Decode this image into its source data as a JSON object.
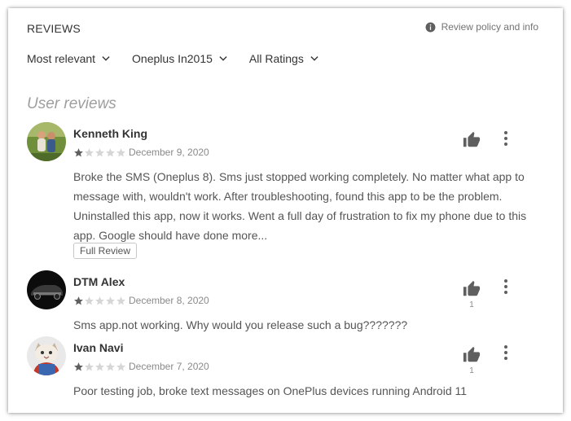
{
  "header": {
    "title": "REVIEWS",
    "policy_label": "Review policy and info"
  },
  "filters": [
    {
      "label": "Most relevant"
    },
    {
      "label": "Oneplus In2015"
    },
    {
      "label": "All Ratings"
    }
  ],
  "section_title": "User reviews",
  "reviews": [
    {
      "author": "Kenneth King",
      "rating": 1,
      "date": "December 9, 2020",
      "text": "Broke the SMS (Oneplus 8). Sms just stopped working completely. No matter what app to message with, wouldn't work. After troubleshooting, found this app to be the problem. Uninstalled this app, now it works. Went a full day of frustration to fix my phone due to this app. Google should have done more...",
      "full_review_label": "Full Review",
      "helpful_count": ""
    },
    {
      "author": "DTM Alex",
      "rating": 1,
      "date": "December 8, 2020",
      "text": "Sms app.not working. Why would you release such a bug???????",
      "helpful_count": "1"
    },
    {
      "author": "Ivan Navi",
      "rating": 1,
      "date": "December 7, 2020",
      "text": "Poor testing job, broke text messages on OnePlus devices running Android 11",
      "helpful_count": "1"
    }
  ],
  "colors": {
    "star_filled": "#5f5f5f",
    "star_empty": "#d6d6d6",
    "icon": "#5f5f5f"
  }
}
